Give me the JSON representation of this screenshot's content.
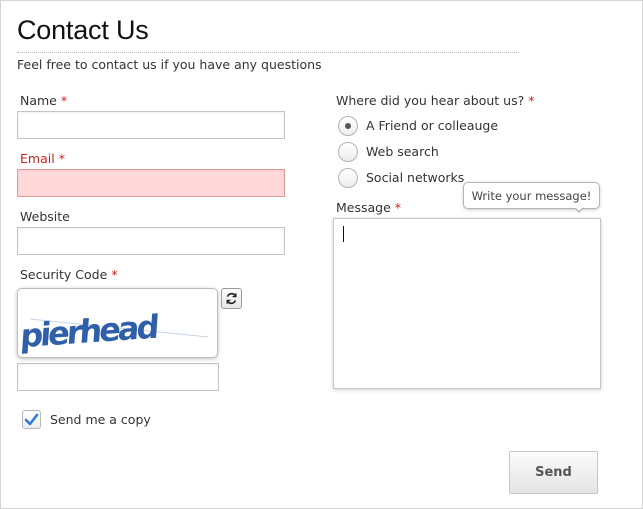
{
  "form": {
    "title": "Contact Us",
    "subtitle": "Feel free to contact us if you have any questions",
    "required_marker": "*",
    "name": {
      "label": "Name",
      "value": "",
      "error": false
    },
    "email": {
      "label": "Email",
      "value": "",
      "error": true
    },
    "website": {
      "label": "Website",
      "value": ""
    },
    "security": {
      "label": "Security Code",
      "captcha_text": "pierhead",
      "value": ""
    },
    "copy_checkbox": {
      "label": "Send me a copy",
      "checked": true
    },
    "source": {
      "label": "Where did you hear about us?",
      "options": [
        {
          "label": "A Friend or colleauge",
          "selected": true
        },
        {
          "label": "Web search",
          "selected": false
        },
        {
          "label": "Social networks",
          "selected": false
        }
      ]
    },
    "message": {
      "label": "Message",
      "tooltip": "Write your message!",
      "value": ""
    },
    "send_label": "Send"
  },
  "colors": {
    "required": "#d42020",
    "error_bg": "#ffd9d9",
    "error_label": "#cc2222",
    "check_blue": "#2f7bd5",
    "captcha_blue": "#2f5fa8"
  },
  "icons": {
    "refresh": "refresh-icon",
    "check": "checkmark-icon"
  }
}
